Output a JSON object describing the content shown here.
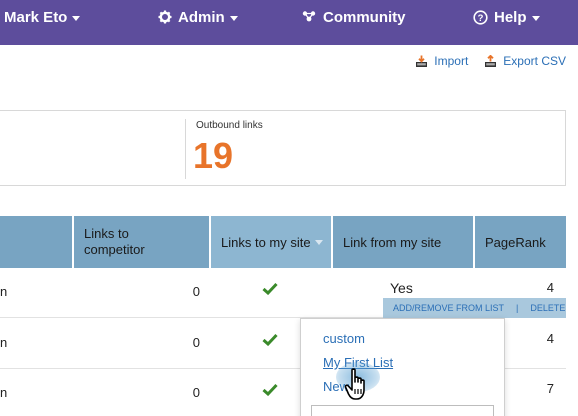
{
  "nav": {
    "user_label": "Mark Eto",
    "admin_label": "Admin",
    "community_label": "Community",
    "help_label": "Help",
    "bg_color": "#5d4d9c"
  },
  "actions": {
    "import_label": "Import",
    "export_label": "Export CSV"
  },
  "stats": {
    "outbound_label": "Outbound links",
    "outbound_value": "19"
  },
  "table": {
    "headers": {
      "competitor": [
        "Links to",
        "competitor"
      ],
      "links_to_site": "Links to my site",
      "link_from_site": "Link from my site",
      "pagerank": "PageRank"
    },
    "rows": [
      {
        "domain": "n",
        "competitor": "0",
        "links_to_site": true,
        "link_from_site": "Yes",
        "pagerank": "4"
      },
      {
        "domain": "n",
        "competitor": "0",
        "links_to_site": true,
        "link_from_site": "",
        "pagerank": "4"
      },
      {
        "domain": "n",
        "competitor": "0",
        "links_to_site": true,
        "link_from_site": "",
        "pagerank": "7"
      }
    ],
    "row_actions": {
      "add_remove": "ADD/REMOVE FROM LIST",
      "separator": "|",
      "delete": "DELETE"
    }
  },
  "dropdown": {
    "items": [
      "custom",
      "My First List",
      "New"
    ]
  },
  "colors": {
    "header_bg": "#78a4c2",
    "accent_orange": "#e8742a",
    "link_blue": "#2b6fb6",
    "check_green": "#3a8a2a"
  }
}
